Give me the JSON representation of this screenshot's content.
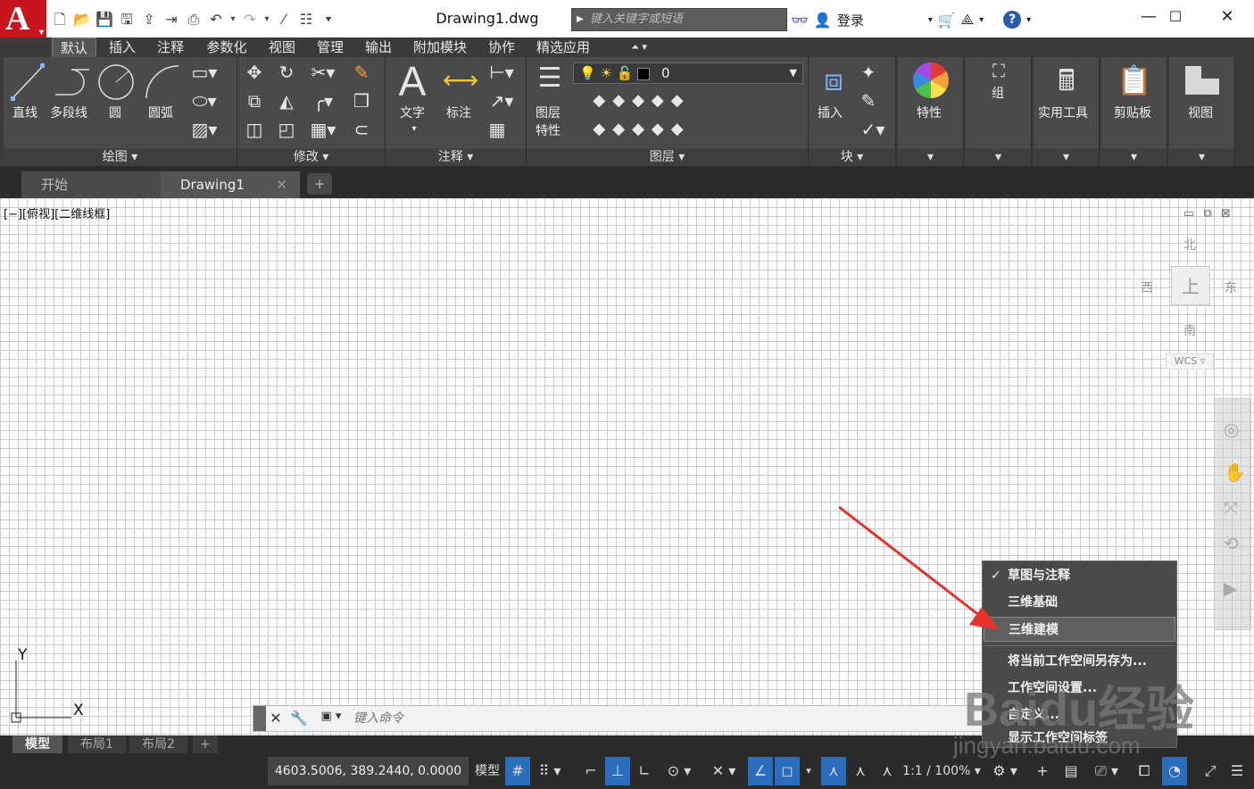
{
  "app": {
    "logo_letter": "A",
    "document_title": "Drawing1.dwg"
  },
  "quick_access": [
    "new-icon",
    "open-icon",
    "save-icon",
    "save-as-icon",
    "publish-icon",
    "import-icon",
    "plot-icon",
    "undo-icon",
    "redo-icon",
    "match-icon",
    "properties-icon",
    "customize-icon"
  ],
  "search": {
    "placeholder": "键入关键字或短语"
  },
  "account": {
    "login_label": "登录"
  },
  "ribbon_tabs": [
    "默认",
    "插入",
    "注释",
    "参数化",
    "视图",
    "管理",
    "输出",
    "附加模块",
    "协作",
    "精选应用"
  ],
  "ribbon_active_tab": "默认",
  "panels": {
    "draw": {
      "title": "绘图",
      "items": [
        "直线",
        "多段线",
        "圆",
        "圆弧"
      ]
    },
    "modify": {
      "title": "修改"
    },
    "annotation": {
      "title": "注释",
      "items": [
        "文字",
        "标注"
      ]
    },
    "layers": {
      "title": "图层",
      "properties_label_1": "图层",
      "properties_label_2": "特性",
      "current_layer": "0"
    },
    "block": {
      "title": "块",
      "insert_label": "插入"
    },
    "properties": {
      "label": "特性"
    },
    "groups": {
      "label": "组"
    },
    "utilities": {
      "label": "实用工具"
    },
    "clipboard": {
      "label": "剪贴板"
    },
    "view": {
      "label": "视图"
    }
  },
  "doc_tabs": [
    {
      "label": "开始"
    },
    {
      "label": "Drawing1"
    }
  ],
  "viewport": {
    "label": "[−][俯视][二维线框]"
  },
  "viewcube": {
    "north": "北",
    "south": "南",
    "east": "东",
    "west": "西",
    "top_face": "上",
    "wcs": "WCS"
  },
  "ucs": {
    "x_label": "X",
    "y_label": "Y"
  },
  "command": {
    "placeholder": "键入命令"
  },
  "layout_tabs": [
    "模型",
    "布局1",
    "布局2"
  ],
  "status": {
    "coordinates": "4603.5006, 389.2440, 0.0000",
    "model_label": "模型",
    "annotation_scale": "1:1 / 100%"
  },
  "workspace_menu": {
    "items": [
      {
        "label": "草图与注释",
        "checked": true
      },
      {
        "label": "三维基础",
        "checked": false
      },
      {
        "label": "三维建模",
        "checked": false,
        "highlighted": true
      },
      {
        "label": "将当前工作空间另存为...",
        "checked": false
      },
      {
        "label": "工作空间设置...",
        "checked": false
      },
      {
        "label": "自定义...",
        "checked": false
      },
      {
        "label": "显示工作空间标签",
        "checked": false
      }
    ]
  },
  "watermark": {
    "brand": "Baidu经验",
    "url": "jingyan.baidu.com"
  },
  "colors": {
    "logo_red": "#c8141c",
    "ribbon_dark": "#3b3b3b",
    "panel_gray": "#4a4a4a",
    "grid_line": "#c9ced6",
    "highlight_blue": "#2a6dbd",
    "arrow_red": "#e8312c"
  }
}
